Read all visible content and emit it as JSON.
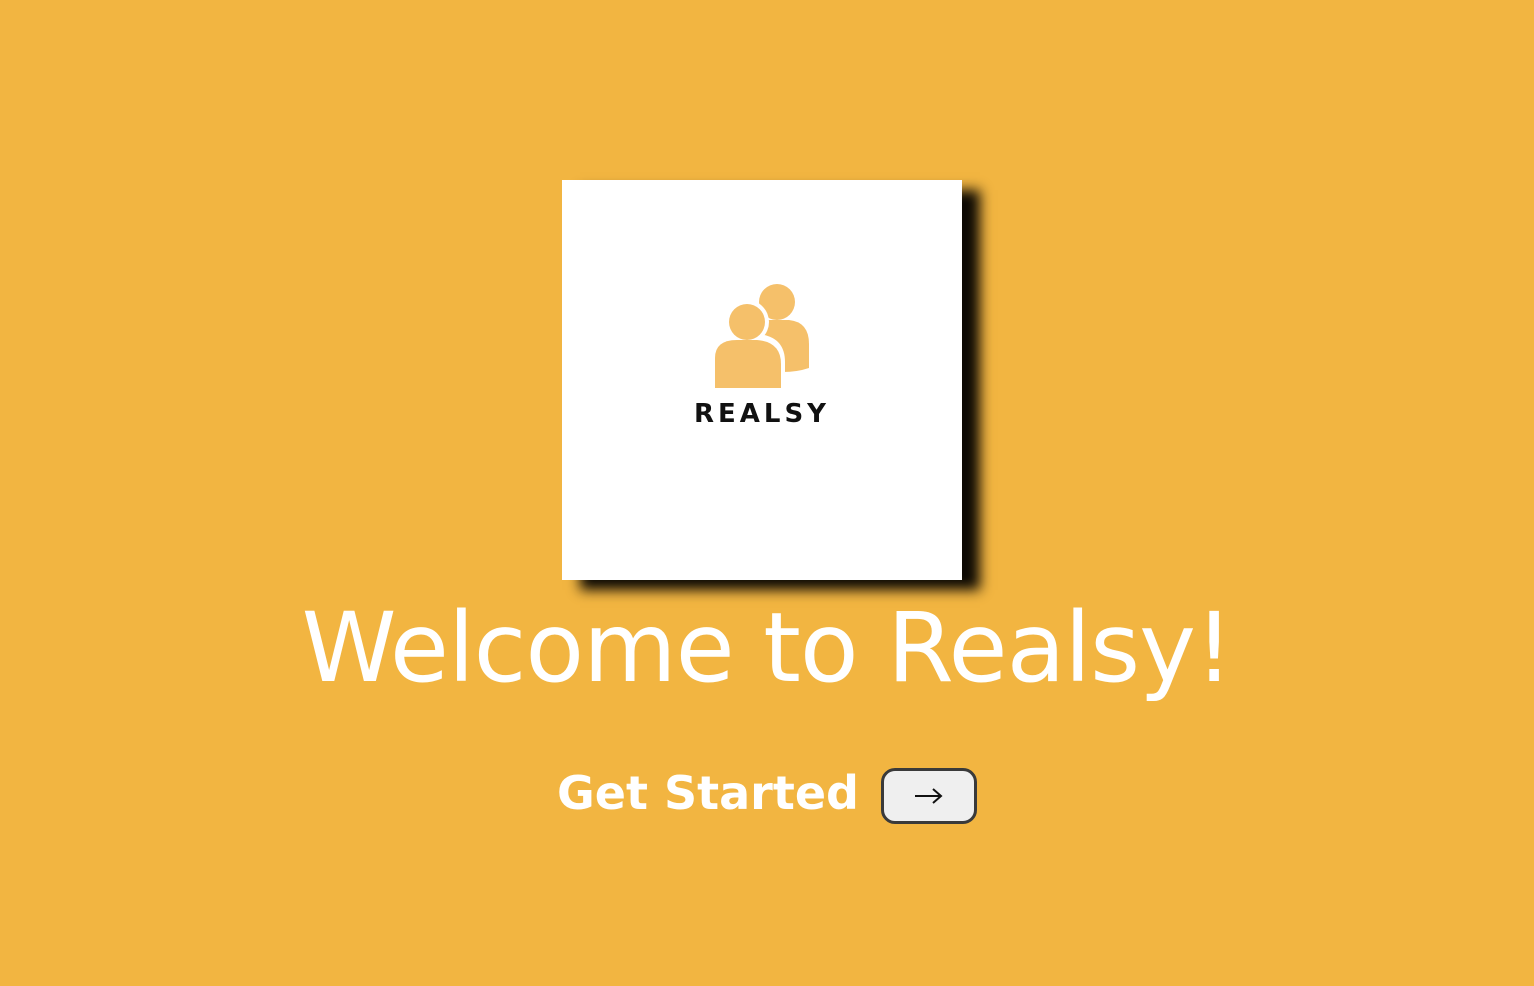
{
  "logo": {
    "wordmark": "REALSY",
    "icon": "people-group-icon",
    "icon_color": "#f5c06a"
  },
  "hero": {
    "title": "Welcome to Realsy!"
  },
  "cta": {
    "label": "Get Started",
    "button_icon": "arrow-right-icon"
  },
  "colors": {
    "background": "#f2b541",
    "card": "#ffffff",
    "text": "#ffffff",
    "wordmark": "#111111",
    "button_bg": "#efefef",
    "button_border": "#3a3a3a"
  }
}
